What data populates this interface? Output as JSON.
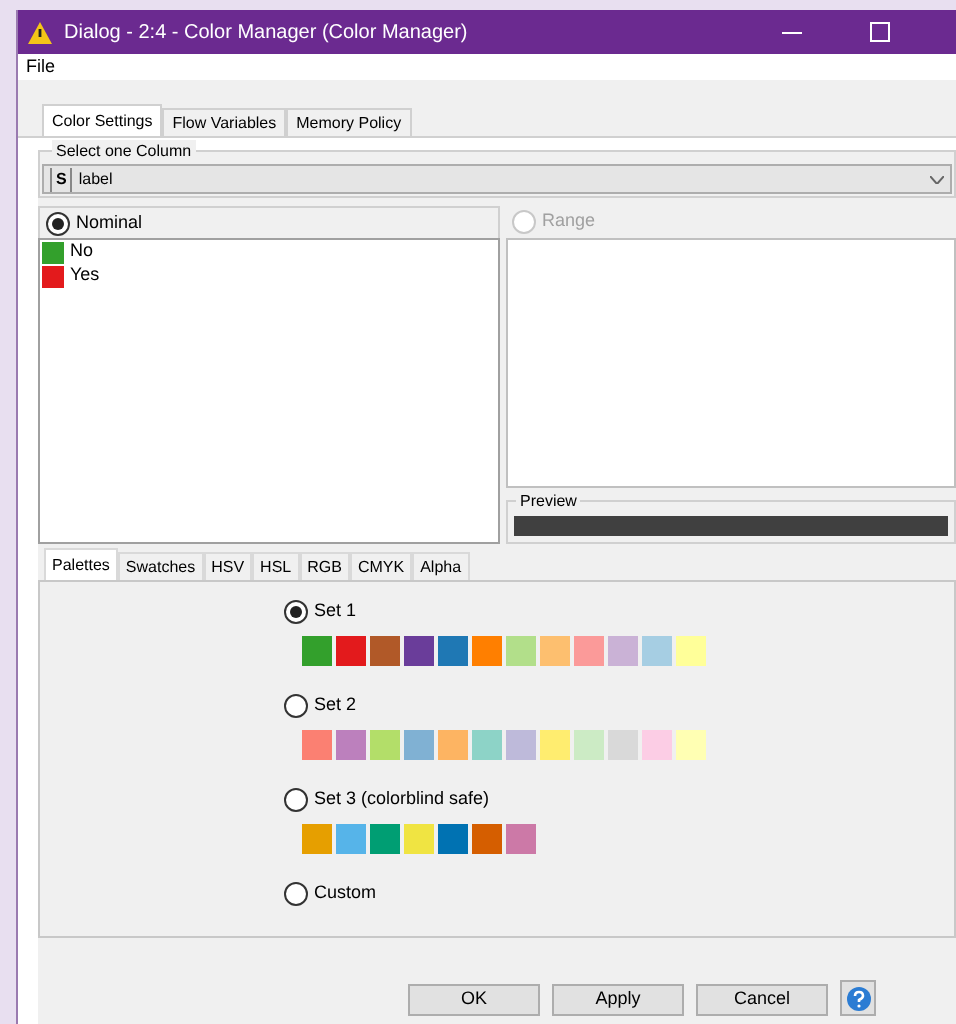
{
  "window": {
    "title": "Dialog - 2:4 - Color Manager (Color Manager)"
  },
  "menu": [
    "File"
  ],
  "tabs": [
    {
      "label": "Color Settings",
      "selected": true
    },
    {
      "label": "Flow Variables",
      "selected": false
    },
    {
      "label": "Memory Policy",
      "selected": false
    }
  ],
  "column_group": {
    "title": "Select one Column",
    "type_badge": "S",
    "value": "label"
  },
  "modes": [
    {
      "label": "Nominal",
      "selected": true,
      "disabled": false
    },
    {
      "label": "Range",
      "selected": false,
      "disabled": true
    }
  ],
  "nominal_values": [
    {
      "label": "No",
      "color": "#33a02c"
    },
    {
      "label": "Yes",
      "color": "#e31a1c"
    }
  ],
  "preview": {
    "title": "Preview"
  },
  "color_tabs": [
    {
      "label": "Palettes",
      "selected": true
    },
    {
      "label": "Swatches",
      "selected": false
    },
    {
      "label": "HSV",
      "selected": false
    },
    {
      "label": "HSL",
      "selected": false
    },
    {
      "label": "RGB",
      "selected": false
    },
    {
      "label": "CMYK",
      "selected": false
    },
    {
      "label": "Alpha",
      "selected": false
    }
  ],
  "palettes": [
    {
      "label": "Set 1",
      "selected": true,
      "swatches": [
        {
          "color": "#33a02c"
        },
        {
          "color": "#e31a1c"
        },
        {
          "color": "#b15928"
        },
        {
          "color": "#6a3d9a"
        },
        {
          "color": "#1f78b4"
        },
        {
          "color": "#ff7f00"
        },
        {
          "color": "#b2df8a"
        },
        {
          "color": "#fdbf6f"
        },
        {
          "color": "#fb9a99"
        },
        {
          "color": "#cab2d6"
        },
        {
          "color": "#a6cee3"
        },
        {
          "color": "#ffff99"
        }
      ]
    },
    {
      "label": "Set 2",
      "selected": false,
      "swatches": [
        {
          "color": "#fb8072"
        },
        {
          "color": "#bc80bd"
        },
        {
          "color": "#b3de69"
        },
        {
          "color": "#80b1d3"
        },
        {
          "color": "#fdb462"
        },
        {
          "color": "#8dd3c7"
        },
        {
          "color": "#bebada"
        },
        {
          "color": "#ffed6f"
        },
        {
          "color": "#ccebc5"
        },
        {
          "color": "#d9d9d9"
        },
        {
          "color": "#fccde5"
        },
        {
          "color": "#ffffb3"
        }
      ]
    },
    {
      "label": "Set 3 (colorblind safe)",
      "selected": false,
      "swatches": [
        {
          "color": "#e69f00"
        },
        {
          "color": "#56b4e9"
        },
        {
          "color": "#009e73"
        },
        {
          "color": "#f0e442"
        },
        {
          "color": "#0072b2"
        },
        {
          "color": "#d55e00"
        },
        {
          "color": "#cc79a7"
        }
      ]
    },
    {
      "label": "Custom",
      "selected": false
    }
  ],
  "buttons": [
    "OK",
    "Apply",
    "Cancel"
  ]
}
